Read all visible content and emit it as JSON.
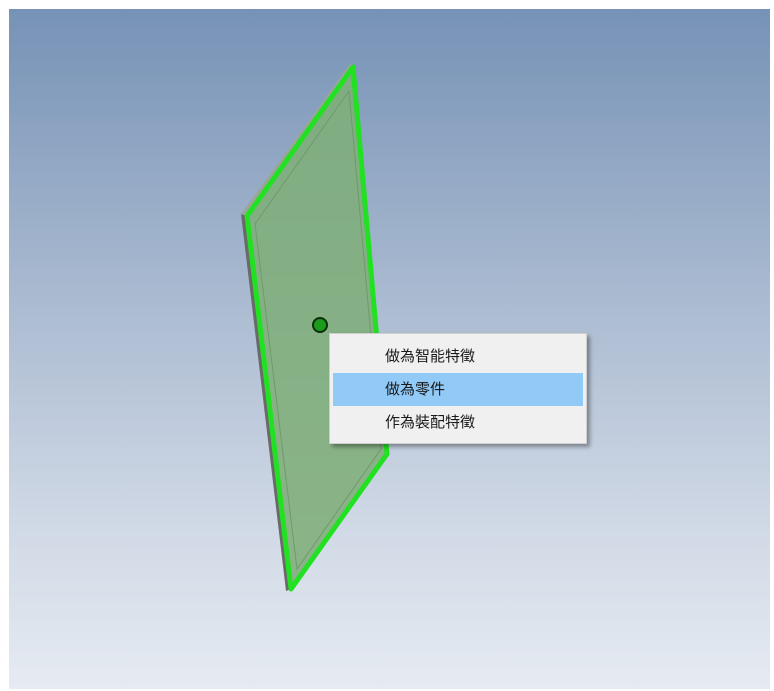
{
  "viewport": {
    "background_top": "#7692b6",
    "background_bottom": "#e6ebf2",
    "selection_color": "#22e022",
    "plate_fill": "#7fae7a"
  },
  "context_menu": {
    "items": [
      {
        "label": "做為智能特徵",
        "highlighted": false
      },
      {
        "label": "做為零件",
        "highlighted": true
      },
      {
        "label": "作為裝配特徵",
        "highlighted": false
      }
    ],
    "highlight_color": "#91c9f7"
  }
}
